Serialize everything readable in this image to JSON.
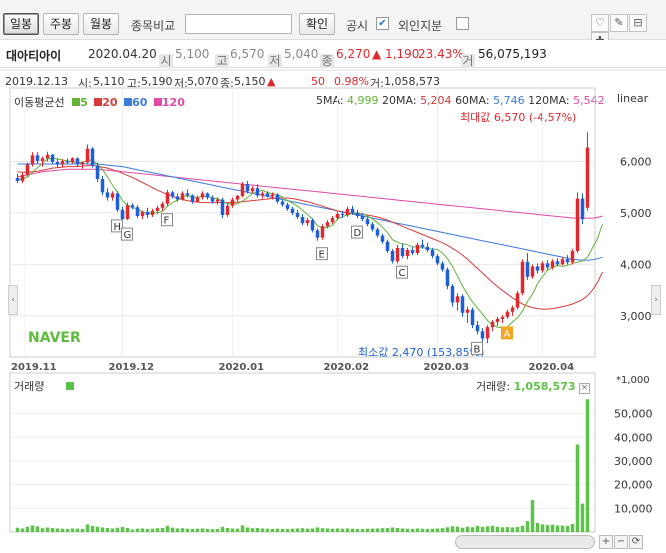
{
  "toolbar": {
    "tab_daily": "일봉",
    "tab_weekly": "주봉",
    "tab_monthly": "월봉",
    "compare_label": "종목비교",
    "compare_value": "",
    "confirm_button": "확인",
    "disclosure_label": "공시",
    "disclosure_checked": "✔",
    "foreign_label": "외인지분",
    "tool_icons": [
      "♡",
      "✎",
      "⊟",
      "✚",
      "⊞"
    ]
  },
  "stock": {
    "name": "대아티아이",
    "date": "2020.04.20",
    "open_icon": "시",
    "open": "5,100",
    "high_icon": "고",
    "high": "6,570",
    "low_icon": "저",
    "low": "5,040",
    "close_icon": "종",
    "close": "6,270",
    "change": "▲ 1,190",
    "change_pct": "23.43%",
    "volume_icon": "거",
    "volume": "56,075,193"
  },
  "cursor": {
    "date": "2019.12.13",
    "open_label": "시:",
    "open": "5,110",
    "high_label": "고:",
    "high": "5,190",
    "low_label": "저:",
    "low": "5,070",
    "close_label": "종:",
    "close": "5,150",
    "arrow": "▲",
    "change": "50",
    "change_pct": "0.98%",
    "volume_label": "거:",
    "volume": "1,058,573"
  },
  "ma": {
    "legend_label": "이동평균선",
    "p5": "5",
    "p20": "20",
    "p60": "60",
    "p120": "120",
    "ma5_label": "5MA:",
    "ma5_value": "4,999",
    "ma20_label": "20MA:",
    "ma20_value": "5,204",
    "ma60_label": "60MA:",
    "ma60_value": "5,746",
    "ma120_label": "120MA:",
    "ma120_value": "5,542"
  },
  "scale_label": "linear",
  "max_label": "최대값 6,570 (-4,57%)",
  "min_label": "최소값 2,470 (153,85%)",
  "watermark": "NAVER",
  "volume_panel": {
    "legend_label": "거래량",
    "cursor_label": "거래량:",
    "cursor_value": "1,058,573",
    "close_icon": "×",
    "unit": "*1,000"
  },
  "colors": {
    "up": "#e0282e",
    "down": "#1d5fd6",
    "ma5": "#62b536",
    "ma20": "#d83a3a",
    "ma60": "#3c7bd9",
    "ma120": "#e04aa8",
    "volume": "#5ec24a",
    "naver": "#5ebd3c"
  },
  "chart_data": {
    "type": "candlestick",
    "x_tick_labels": [
      "2019.11",
      "2019.12",
      "2020.01",
      "2020.02",
      "2020.03",
      "2020.04"
    ],
    "y_ticks": [
      3000,
      4000,
      5000,
      6000
    ],
    "y_tick_labels": [
      "3,000",
      "4,000",
      "5,000",
      "6,000"
    ],
    "volume_ticks": [
      10000,
      20000,
      30000,
      40000,
      50000
    ],
    "volume_tick_labels": [
      "10,000",
      "20,000",
      "30,000",
      "40,000",
      "50,000"
    ],
    "ylim": [
      2200,
      7000
    ],
    "volume_ylim": [
      0,
      60000
    ],
    "event_markers": [
      "H",
      "G",
      "F",
      "E",
      "D",
      "C",
      "B",
      "A"
    ],
    "event_marker_index": [
      20,
      22,
      30,
      61,
      68,
      77,
      92,
      98
    ],
    "candles": [
      [
        5680,
        5760,
        5580,
        5620
      ],
      [
        5620,
        5780,
        5580,
        5740
      ],
      [
        5740,
        5980,
        5700,
        5940
      ],
      [
        5940,
        6180,
        5900,
        6120
      ],
      [
        6120,
        6180,
        5960,
        6010
      ],
      [
        6010,
        6100,
        5900,
        6060
      ],
      [
        6060,
        6190,
        6000,
        6130
      ],
      [
        6130,
        6150,
        5960,
        5990
      ],
      [
        5990,
        6060,
        5880,
        5940
      ],
      [
        5940,
        6040,
        5880,
        6010
      ],
      [
        6010,
        6060,
        5940,
        5980
      ],
      [
        5980,
        6080,
        5960,
        6060
      ],
      [
        6060,
        6080,
        5900,
        5940
      ],
      [
        5940,
        6000,
        5860,
        5980
      ],
      [
        5980,
        6330,
        5960,
        6250
      ],
      [
        6250,
        6280,
        5880,
        5920
      ],
      [
        5920,
        5980,
        5600,
        5660
      ],
      [
        5660,
        5720,
        5340,
        5400
      ],
      [
        5400,
        5480,
        5240,
        5300
      ],
      [
        5300,
        5420,
        5240,
        5380
      ],
      [
        5380,
        5420,
        5020,
        5060
      ],
      [
        5060,
        5120,
        4800,
        4880
      ],
      [
        4880,
        5200,
        4860,
        5150
      ],
      [
        5150,
        5190,
        5070,
        5110
      ],
      [
        5110,
        5150,
        4900,
        4940
      ],
      [
        4940,
        5050,
        4880,
        5020
      ],
      [
        5020,
        5100,
        4900,
        4960
      ],
      [
        4960,
        5080,
        4920,
        5040
      ],
      [
        5040,
        5140,
        4980,
        5100
      ],
      [
        5100,
        5220,
        5040,
        5180
      ],
      [
        5180,
        5450,
        5140,
        5400
      ],
      [
        5400,
        5430,
        5280,
        5320
      ],
      [
        5320,
        5380,
        5220,
        5260
      ],
      [
        5260,
        5420,
        5240,
        5380
      ],
      [
        5380,
        5460,
        5300,
        5340
      ],
      [
        5340,
        5360,
        5180,
        5220
      ],
      [
        5220,
        5340,
        5200,
        5300
      ],
      [
        5300,
        5420,
        5260,
        5380
      ],
      [
        5380,
        5400,
        5260,
        5300
      ],
      [
        5300,
        5340,
        5180,
        5220
      ],
      [
        5220,
        5300,
        5160,
        5260
      ],
      [
        5260,
        5300,
        4900,
        4960
      ],
      [
        4960,
        5180,
        4920,
        5140
      ],
      [
        5140,
        5300,
        5100,
        5260
      ],
      [
        5260,
        5350,
        5220,
        5330
      ],
      [
        5330,
        5600,
        5300,
        5560
      ],
      [
        5560,
        5620,
        5380,
        5420
      ],
      [
        5420,
        5520,
        5380,
        5480
      ],
      [
        5480,
        5560,
        5300,
        5340
      ],
      [
        5340,
        5420,
        5280,
        5380
      ],
      [
        5380,
        5420,
        5300,
        5320
      ],
      [
        5320,
        5400,
        5260,
        5360
      ],
      [
        5360,
        5380,
        5180,
        5220
      ],
      [
        5220,
        5260,
        5120,
        5160
      ],
      [
        5160,
        5200,
        5040,
        5080
      ],
      [
        5080,
        5120,
        4960,
        5000
      ],
      [
        5000,
        5060,
        4880,
        4920
      ],
      [
        4920,
        4980,
        4760,
        4800
      ],
      [
        4800,
        4900,
        4740,
        4860
      ],
      [
        4860,
        4900,
        4620,
        4660
      ],
      [
        4660,
        4700,
        4460,
        4520
      ],
      [
        4520,
        4780,
        4480,
        4740
      ],
      [
        4740,
        4860,
        4700,
        4820
      ],
      [
        4820,
        4940,
        4780,
        4900
      ],
      [
        4900,
        5020,
        4860,
        4980
      ],
      [
        4980,
        5040,
        4900,
        4960
      ],
      [
        4960,
        5120,
        4920,
        5080
      ],
      [
        5080,
        5140,
        4960,
        5000
      ],
      [
        5000,
        5060,
        4900,
        4940
      ],
      [
        4940,
        5000,
        4840,
        4880
      ],
      [
        4880,
        4920,
        4740,
        4780
      ],
      [
        4780,
        4820,
        4640,
        4680
      ],
      [
        4680,
        4720,
        4520,
        4560
      ],
      [
        4560,
        4600,
        4400,
        4440
      ],
      [
        4440,
        4480,
        4220,
        4260
      ],
      [
        4260,
        4300,
        4020,
        4060
      ],
      [
        4060,
        4380,
        4020,
        4320
      ],
      [
        4320,
        4400,
        4120,
        4160
      ],
      [
        4160,
        4320,
        4100,
        4280
      ],
      [
        4280,
        4340,
        4180,
        4220
      ],
      [
        4220,
        4420,
        4180,
        4380
      ],
      [
        4380,
        4480,
        4300,
        4340
      ],
      [
        4340,
        4420,
        4240,
        4280
      ],
      [
        4280,
        4320,
        4120,
        4160
      ],
      [
        4160,
        4200,
        3980,
        4020
      ],
      [
        4020,
        4060,
        3860,
        3900
      ],
      [
        3900,
        3940,
        3520,
        3580
      ],
      [
        3580,
        3620,
        3180,
        3260
      ],
      [
        3260,
        3440,
        3100,
        3380
      ],
      [
        3380,
        3420,
        2980,
        3060
      ],
      [
        3060,
        3180,
        2860,
        3120
      ],
      [
        3120,
        3160,
        2760,
        2820
      ],
      [
        2820,
        2900,
        2640,
        2700
      ],
      [
        2700,
        2760,
        2500,
        2560
      ],
      [
        2560,
        2820,
        2470,
        2780
      ],
      [
        2780,
        2920,
        2700,
        2880
      ],
      [
        2880,
        2980,
        2800,
        2940
      ],
      [
        2940,
        3020,
        2860,
        2980
      ],
      [
        2980,
        3120,
        2940,
        3080
      ],
      [
        3080,
        3200,
        3000,
        3160
      ],
      [
        3160,
        3480,
        3120,
        3440
      ],
      [
        3440,
        4100,
        3400,
        4050
      ],
      [
        4050,
        4220,
        3700,
        3760
      ],
      [
        3760,
        4000,
        3720,
        3960
      ],
      [
        3960,
        4020,
        3820,
        3880
      ],
      [
        3880,
        4060,
        3840,
        4020
      ],
      [
        4020,
        4080,
        3900,
        3940
      ],
      [
        3940,
        4100,
        3900,
        4060
      ],
      [
        4060,
        4120,
        3960,
        4000
      ],
      [
        4000,
        4140,
        3980,
        4100
      ],
      [
        4100,
        4180,
        4000,
        4040
      ],
      [
        4040,
        4300,
        4000,
        4260
      ],
      [
        4260,
        5400,
        4220,
        5280
      ],
      [
        5280,
        5380,
        4780,
        4880
      ],
      [
        5100,
        6570,
        5040,
        6270
      ]
    ],
    "ma5": [
      5650,
      5660,
      5700,
      5790,
      5880,
      5960,
      6050,
      6060,
      6050,
      6030,
      6010,
      5990,
      5980,
      5980,
      6020,
      6030,
      5940,
      5840,
      5700,
      5540,
      5400,
      5240,
      5150,
      5100,
      5080,
      5010,
      4990,
      5000,
      5000,
      5030,
      5130,
      5200,
      5250,
      5310,
      5340,
      5310,
      5300,
      5320,
      5320,
      5290,
      5280,
      5220,
      5180,
      5170,
      5180,
      5230,
      5300,
      5380,
      5410,
      5440,
      5390,
      5380,
      5350,
      5310,
      5240,
      5190,
      5130,
      5050,
      4970,
      4880,
      4750,
      4710,
      4720,
      4760,
      4880,
      4930,
      4960,
      4990,
      5000,
      4980,
      4940,
      4880,
      4810,
      4720,
      4620,
      4480,
      4430,
      4400,
      4380,
      4340,
      4340,
      4330,
      4300,
      4300,
      4290,
      4220,
      4110,
      3960,
      3770,
      3580,
      3420,
      3270,
      3150,
      3030,
      2910,
      2830,
      2780,
      2770,
      2790,
      2880,
      2960,
      3090,
      3280,
      3420,
      3620,
      3760,
      3890,
      3940,
      3980,
      3960,
      3980,
      4020,
      4040,
      4070,
      4140,
      4320,
      4500,
      4780
    ],
    "ma20": [
      5800,
      5790,
      5790,
      5800,
      5810,
      5830,
      5850,
      5870,
      5880,
      5890,
      5900,
      5900,
      5900,
      5910,
      5920,
      5920,
      5910,
      5890,
      5870,
      5840,
      5810,
      5770,
      5730,
      5690,
      5640,
      5590,
      5540,
      5490,
      5440,
      5400,
      5360,
      5320,
      5290,
      5260,
      5240,
      5220,
      5210,
      5200,
      5200,
      5200,
      5200,
      5200,
      5200,
      5200,
      5210,
      5220,
      5230,
      5240,
      5250,
      5260,
      5270,
      5280,
      5290,
      5290,
      5290,
      5280,
      5260,
      5240,
      5220,
      5190,
      5160,
      5130,
      5100,
      5070,
      5040,
      5020,
      5000,
      4990,
      4980,
      4970,
      4960,
      4940,
      4920,
      4890,
      4860,
      4820,
      4780,
      4740,
      4700,
      4660,
      4620,
      4580,
      4540,
      4500,
      4460,
      4420,
      4370,
      4310,
      4250,
      4180,
      4100,
      4010,
      3920,
      3830,
      3740,
      3650,
      3570,
      3490,
      3420,
      3350,
      3290,
      3230,
      3190,
      3160,
      3140,
      3130,
      3130,
      3140,
      3160,
      3180,
      3200,
      3230,
      3270,
      3320,
      3390,
      3500,
      3650,
      3850
    ],
    "ma60": [
      5950,
      5950,
      5950,
      5950,
      5950,
      5950,
      5950,
      5950,
      5950,
      5950,
      5950,
      5950,
      5950,
      5950,
      5950,
      5950,
      5950,
      5940,
      5930,
      5920,
      5910,
      5900,
      5880,
      5860,
      5840,
      5820,
      5800,
      5780,
      5760,
      5740,
      5720,
      5700,
      5680,
      5660,
      5640,
      5620,
      5600,
      5580,
      5560,
      5540,
      5520,
      5500,
      5480,
      5460,
      5440,
      5420,
      5400,
      5380,
      5360,
      5340,
      5320,
      5300,
      5280,
      5260,
      5240,
      5220,
      5200,
      5180,
      5160,
      5140,
      5120,
      5100,
      5080,
      5060,
      5040,
      5020,
      5000,
      4980,
      4960,
      4940,
      4920,
      4900,
      4880,
      4860,
      4840,
      4820,
      4800,
      4780,
      4760,
      4740,
      4720,
      4700,
      4680,
      4660,
      4640,
      4620,
      4600,
      4580,
      4560,
      4540,
      4520,
      4500,
      4480,
      4460,
      4440,
      4420,
      4400,
      4380,
      4360,
      4340,
      4320,
      4300,
      4280,
      4260,
      4240,
      4220,
      4200,
      4180,
      4160,
      4140,
      4120,
      4100,
      4090,
      4080,
      4080,
      4090,
      4110,
      4140
    ],
    "ma120": [
      5700,
      5720,
      5740,
      5760,
      5780,
      5800,
      5810,
      5820,
      5830,
      5840,
      5850,
      5850,
      5850,
      5850,
      5850,
      5850,
      5850,
      5840,
      5830,
      5820,
      5810,
      5800,
      5790,
      5780,
      5770,
      5760,
      5750,
      5740,
      5730,
      5720,
      5710,
      5700,
      5690,
      5680,
      5670,
      5660,
      5650,
      5640,
      5630,
      5620,
      5610,
      5600,
      5590,
      5580,
      5570,
      5560,
      5550,
      5540,
      5530,
      5520,
      5510,
      5500,
      5490,
      5480,
      5470,
      5460,
      5450,
      5440,
      5430,
      5420,
      5410,
      5400,
      5390,
      5380,
      5370,
      5360,
      5350,
      5340,
      5330,
      5320,
      5310,
      5300,
      5290,
      5280,
      5270,
      5260,
      5250,
      5240,
      5230,
      5220,
      5210,
      5200,
      5190,
      5180,
      5170,
      5160,
      5150,
      5140,
      5130,
      5120,
      5110,
      5100,
      5090,
      5080,
      5070,
      5060,
      5050,
      5040,
      5030,
      5020,
      5010,
      5000,
      4990,
      4980,
      4970,
      4960,
      4950,
      4940,
      4930,
      4920,
      4910,
      4900,
      4900,
      4900,
      4900,
      4900,
      4910,
      4940
    ],
    "volume": [
      1800,
      1500,
      2200,
      2800,
      2400,
      1600,
      1900,
      1700,
      1500,
      1400,
      1300,
      1500,
      1400,
      1300,
      3200,
      2600,
      2200,
      1900,
      1700,
      1500,
      1800,
      2100,
      1700,
      1059,
      1400,
      1500,
      1300,
      1400,
      1600,
      1700,
      2600,
      1800,
      1500,
      1600,
      1400,
      1300,
      1400,
      1500,
      1300,
      1200,
      1300,
      2200,
      1700,
      1500,
      1400,
      2800,
      1900,
      1600,
      1700,
      1500,
      1400,
      1300,
      1400,
      1300,
      1300,
      1400,
      1500,
      1600,
      1400,
      1500,
      1900,
      1600,
      1500,
      1400,
      1500,
      1400,
      1500,
      1400,
      1300,
      1300,
      1400,
      1400,
      1500,
      1600,
      1700,
      1900,
      1700,
      1500,
      1400,
      1300,
      1500,
      1400,
      1300,
      1400,
      1500,
      1600,
      2000,
      2400,
      2300,
      1800,
      2200,
      2000,
      2600,
      2200,
      2400,
      2600,
      2200,
      2000,
      2100,
      1900,
      2100,
      2600,
      4600,
      13500,
      3800,
      3200,
      2900,
      3100,
      2800,
      2700,
      2600,
      3400,
      37000,
      12000,
      56075
    ]
  }
}
